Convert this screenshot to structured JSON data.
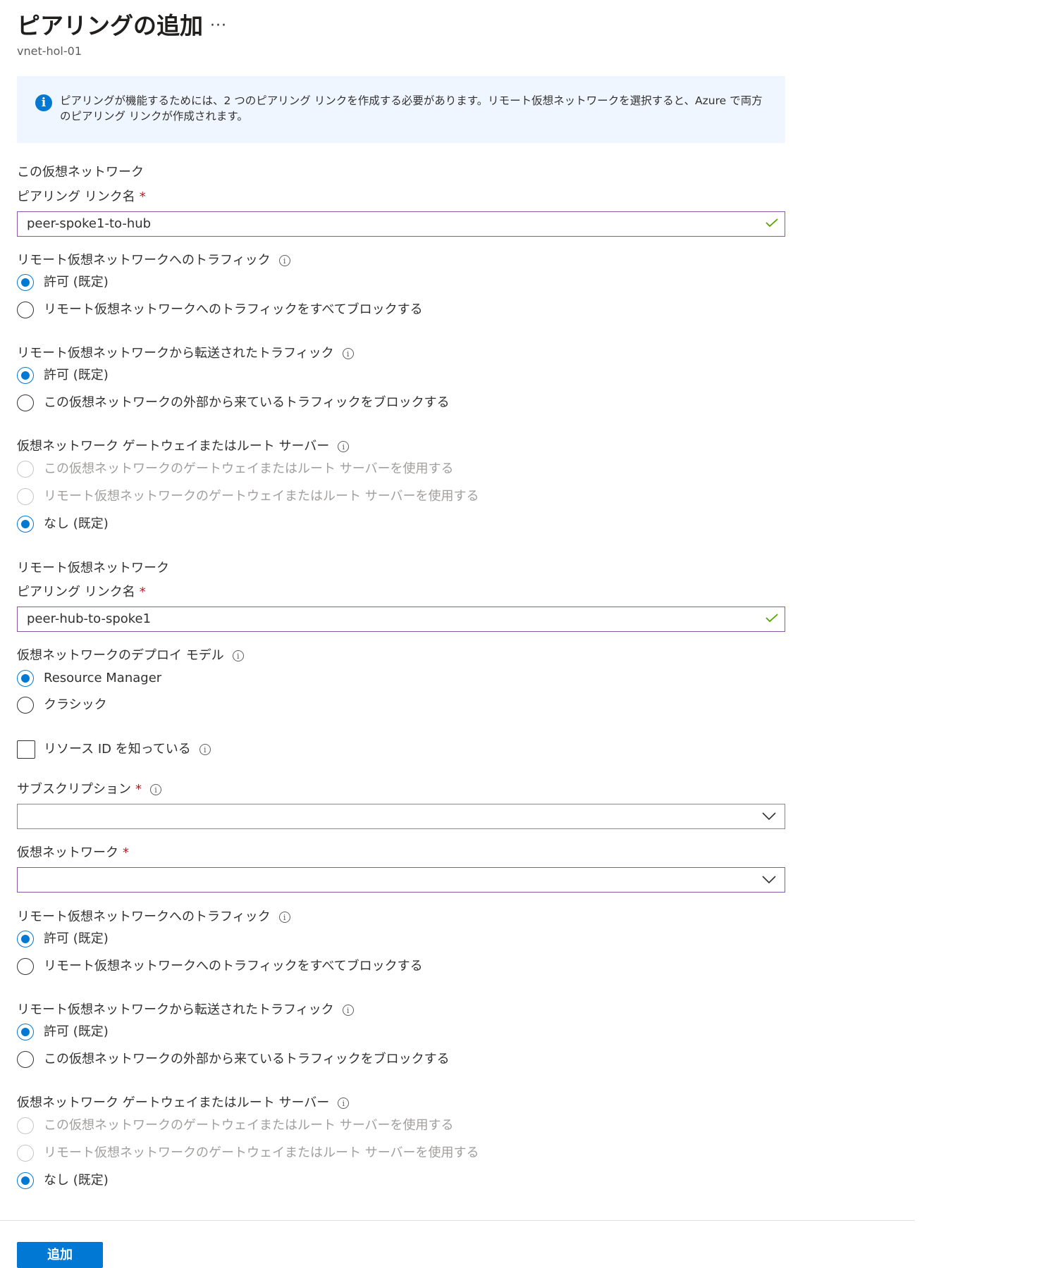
{
  "header": {
    "title": "ピアリングの追加",
    "more_label": "···",
    "subtitle": "vnet-hol-01"
  },
  "info_banner": {
    "icon": "info-icon",
    "icon_glyph": "i",
    "text": "ピアリングが機能するためには、2 つのピアリング リンクを作成する必要があります。リモート仮想ネットワークを選択すると、Azure で両方のピアリング リンクが作成されます。"
  },
  "this_vnet": {
    "section_title": "この仮想ネットワーク",
    "link_name_label": "ピアリング リンク名",
    "link_name_value": "peer-spoke1-to-hub",
    "traffic_to_remote": {
      "label": "リモート仮想ネットワークへのトラフィック",
      "options": [
        "許可 (既定)",
        "リモート仮想ネットワークへのトラフィックをすべてブロックする"
      ],
      "selected": "許可 (既定)"
    },
    "forwarded_traffic": {
      "label": "リモート仮想ネットワークから転送されたトラフィック",
      "options": [
        "許可 (既定)",
        "この仮想ネットワークの外部から来ているトラフィックをブロックする"
      ],
      "selected": "許可 (既定)"
    },
    "gateway": {
      "label": "仮想ネットワーク ゲートウェイまたはルート サーバー",
      "options": [
        "この仮想ネットワークのゲートウェイまたはルート サーバーを使用する",
        "リモート仮想ネットワークのゲートウェイまたはルート サーバーを使用する",
        "なし (既定)"
      ],
      "selected": "なし (既定)"
    }
  },
  "remote_vnet": {
    "section_title": "リモート仮想ネットワーク",
    "link_name_label": "ピアリング リンク名",
    "link_name_value": "peer-hub-to-spoke1",
    "deployment_model": {
      "label": "仮想ネットワークのデプロイ モデル",
      "options": [
        "Resource Manager",
        "クラシック"
      ],
      "selected": "Resource Manager"
    },
    "resource_id_checkbox": {
      "label": "リソース ID を知っている",
      "checked": false
    },
    "subscription": {
      "label": "サブスクリプション",
      "value": ""
    },
    "virtual_network": {
      "label": "仮想ネットワーク",
      "value": ""
    },
    "traffic_to_remote": {
      "label": "リモート仮想ネットワークへのトラフィック",
      "options": [
        "許可 (既定)",
        "リモート仮想ネットワークへのトラフィックをすべてブロックする"
      ],
      "selected": "許可 (既定)"
    },
    "forwarded_traffic": {
      "label": "リモート仮想ネットワークから転送されたトラフィック",
      "options": [
        "許可 (既定)",
        "この仮想ネットワークの外部から来ているトラフィックをブロックする"
      ],
      "selected": "許可 (既定)"
    },
    "gateway": {
      "label": "仮想ネットワーク ゲートウェイまたはルート サーバー",
      "options": [
        "この仮想ネットワークのゲートウェイまたはルート サーバーを使用する",
        "リモート仮想ネットワークのゲートウェイまたはルート サーバーを使用する",
        "なし (既定)"
      ],
      "selected": "なし (既定)"
    }
  },
  "common": {
    "required_mark": "*",
    "tooltip_glyph": "i"
  },
  "footer": {
    "add_button_label": "追加"
  },
  "colors": {
    "accent": "#0078d4",
    "valid_check": "#57a300",
    "required": "#a4262c",
    "focus_border": "#8a58a8",
    "info_background": "#f0f6ff"
  }
}
